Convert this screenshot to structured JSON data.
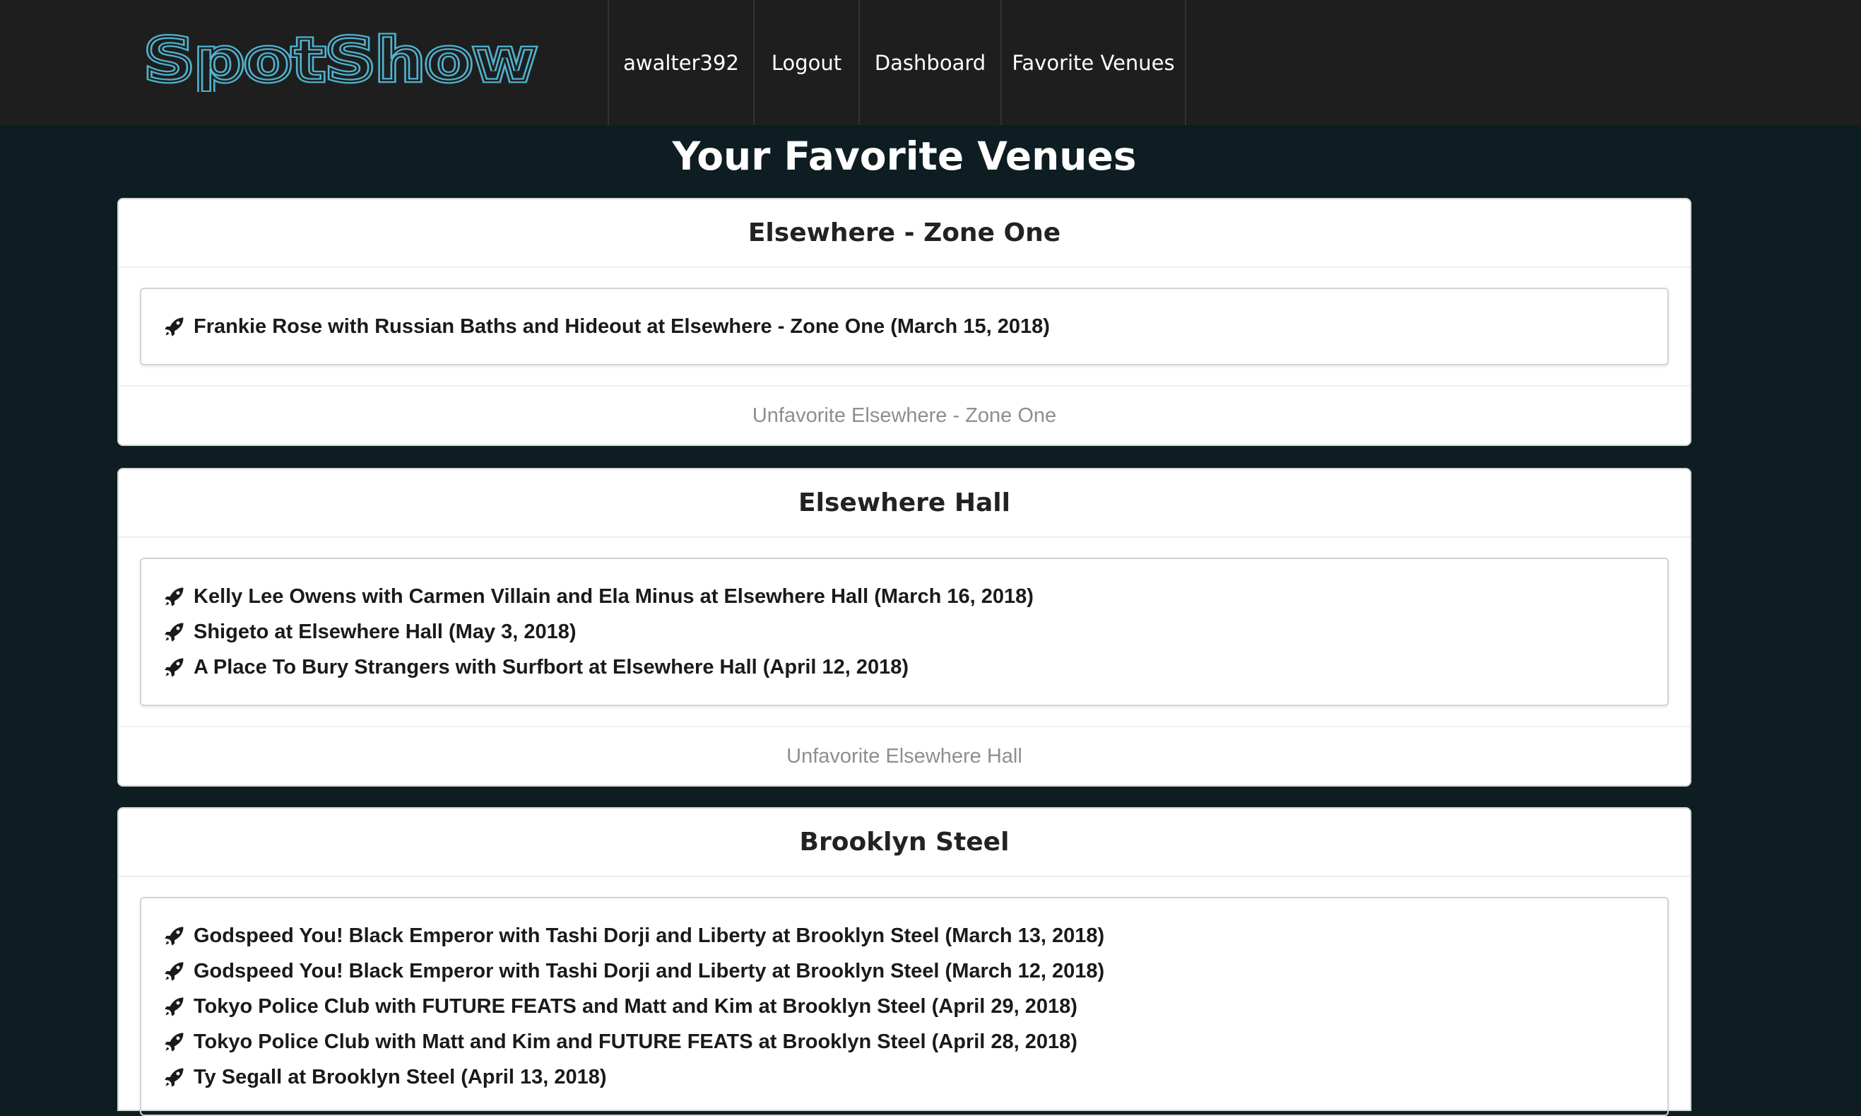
{
  "header": {
    "brand": "SpotShow",
    "nav": {
      "username": "awalter392",
      "logout": "Logout",
      "dashboard": "Dashboard",
      "favorites": "Favorite Venues"
    }
  },
  "page_title": "Your Favorite Venues",
  "venues": [
    {
      "name": "Elsewhere - Zone One",
      "shows": [
        "Frankie Rose with Russian Baths and Hideout at Elsewhere - Zone One (March 15, 2018)"
      ],
      "unfavorite": "Unfavorite Elsewhere - Zone One"
    },
    {
      "name": "Elsewhere Hall",
      "shows": [
        "Kelly Lee Owens with Carmen Villain and Ela Minus at Elsewhere Hall (March 16, 2018)",
        "Shigeto at Elsewhere Hall (May 3, 2018)",
        "A Place To Bury Strangers with Surfbort at Elsewhere Hall (April 12, 2018)"
      ],
      "unfavorite": "Unfavorite Elsewhere Hall"
    },
    {
      "name": "Brooklyn Steel",
      "shows": [
        "Godspeed You! Black Emperor with Tashi Dorji and Liberty at Brooklyn Steel (March 13, 2018)",
        "Godspeed You! Black Emperor with Tashi Dorji and Liberty at Brooklyn Steel (March 12, 2018)",
        "Tokyo Police Club with FUTURE FEATS and Matt and Kim at Brooklyn Steel (April 29, 2018)",
        "Tokyo Police Club with Matt and Kim and FUTURE FEATS at Brooklyn Steel (April 28, 2018)",
        "Ty Segall at Brooklyn Steel (April 13, 2018)"
      ]
    }
  ],
  "icons": {
    "show_bullet": "rocket-icon"
  },
  "colors": {
    "brand": "#4fb3cf",
    "navbar": "#1e1e1e",
    "background": "#0d1d22"
  }
}
